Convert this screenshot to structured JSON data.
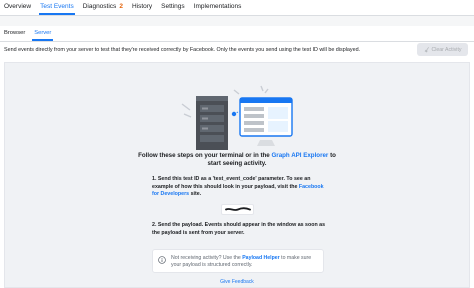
{
  "nav": {
    "tabs": [
      {
        "label": "Overview"
      },
      {
        "label": "Test Events"
      },
      {
        "label": "Diagnostics",
        "badge": "2"
      },
      {
        "label": "History"
      },
      {
        "label": "Settings"
      },
      {
        "label": "Implementations"
      }
    ],
    "active_tab": "Test Events"
  },
  "subnav": {
    "tabs": [
      {
        "label": "Browser"
      },
      {
        "label": "Server"
      }
    ],
    "active_tab": "Server"
  },
  "description": "Send events directly from your server to test that they're received correctly by Facebook. Only the events you send using the test ID will be displayed.",
  "clear_activity_label": "Clear Activity",
  "main": {
    "heading_prefix": "Follow these steps on your terminal or in the ",
    "heading_link": "Graph API Explorer",
    "heading_suffix": " to start seeing activity.",
    "step1_prefix": "1. Send this test ID as a 'test_event_code' parameter. To see an example of how this should look in your payload, visit the ",
    "step1_link": "Facebook for Developers",
    "step1_suffix": " site.",
    "step2": "2. Send the payload. Events should appear in the window as soon as the payload is sent from your server.",
    "info_prefix": "Not receiving activity? Use the ",
    "info_link": "Payload Helper",
    "info_suffix": " to make sure your payload is structured correctly.",
    "feedback_label": "Give Feedback"
  },
  "colors": {
    "accent": "#1877f2",
    "badge": "#e4630b",
    "panel_bg": "#f0f2f5"
  }
}
